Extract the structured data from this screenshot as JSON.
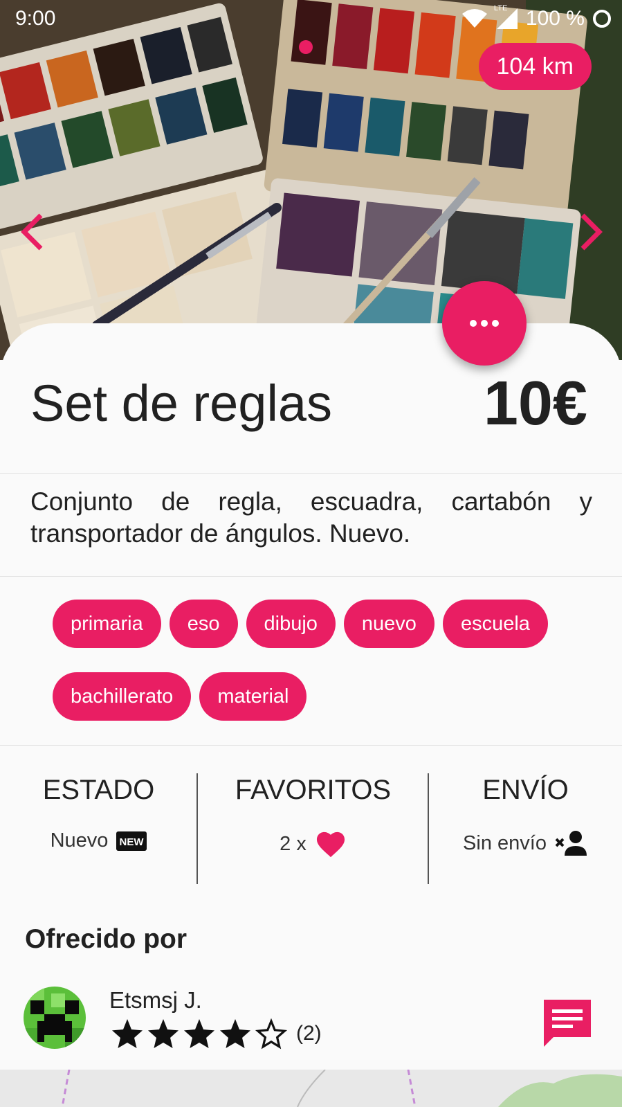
{
  "status_bar": {
    "time": "9:00",
    "network": "LTE",
    "battery": "100 %"
  },
  "hero": {
    "distance": "104 km",
    "prev_icon": "chevron-left-icon",
    "next_icon": "chevron-right-icon",
    "more_icon": "more-horiz-icon"
  },
  "product": {
    "title": "Set de reglas",
    "price": "10€",
    "description": "Conjunto de regla, escuadra, cartabón y transportador de ángulos. Nuevo.",
    "tags": [
      "primaria",
      "eso",
      "dibujo",
      "nuevo",
      "escuela",
      "bachillerato",
      "material"
    ]
  },
  "info": {
    "estado": {
      "label": "ESTADO",
      "value": "Nuevo",
      "icon": "new-badge-icon"
    },
    "favoritos": {
      "label": "FAVORITOS",
      "value": "2 x",
      "icon": "heart-icon"
    },
    "envio": {
      "label": "ENVÍO",
      "value": "Sin envío",
      "icon": "person-remove-icon"
    }
  },
  "seller": {
    "section_title": "Ofrecido por",
    "name": "Etsmsj J.",
    "rating": 4,
    "rating_max": 5,
    "rating_count": "(2)",
    "chat_icon": "chat-icon"
  },
  "colors": {
    "accent": "#e91e63",
    "text": "#212121",
    "background": "#fafafa"
  }
}
